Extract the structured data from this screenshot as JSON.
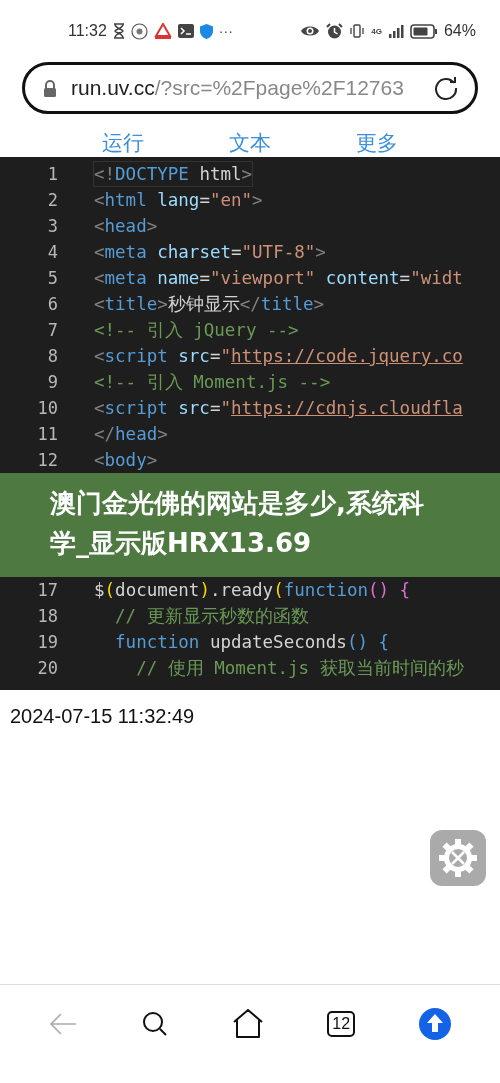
{
  "status_bar": {
    "time": "11:32",
    "more": "···",
    "network": "4G",
    "battery": "64%"
  },
  "address_bar": {
    "host": "run.uv.cc",
    "path": "/?src=%2Fpage%2F12763"
  },
  "toolbar": [
    {
      "label": "运行"
    },
    {
      "label": "文本"
    },
    {
      "label": "更多"
    }
  ],
  "editor": {
    "lines_top": [
      {
        "number": "1",
        "current": true,
        "tokens": [
          {
            "kind": "p",
            "t": "<!"
          },
          {
            "kind": "tag",
            "t": "DOCTYPE"
          },
          {
            "kind": "txt",
            "t": " html"
          },
          {
            "kind": "p",
            "t": ">"
          }
        ]
      },
      {
        "number": "2",
        "current": false,
        "tokens": [
          {
            "kind": "p",
            "t": "<"
          },
          {
            "kind": "tag",
            "t": "html"
          },
          {
            "kind": "attr",
            "t": " lang"
          },
          {
            "kind": "txt",
            "t": "="
          },
          {
            "kind": "str",
            "t": "\"en\""
          },
          {
            "kind": "p",
            "t": ">"
          }
        ]
      },
      {
        "number": "3",
        "current": false,
        "tokens": [
          {
            "kind": "p",
            "t": "<"
          },
          {
            "kind": "tag",
            "t": "head"
          },
          {
            "kind": "p",
            "t": ">"
          }
        ]
      },
      {
        "number": "4",
        "current": false,
        "tokens": [
          {
            "kind": "p",
            "t": "<"
          },
          {
            "kind": "tag",
            "t": "meta"
          },
          {
            "kind": "attr",
            "t": " charset"
          },
          {
            "kind": "txt",
            "t": "="
          },
          {
            "kind": "str",
            "t": "\"UTF-8\""
          },
          {
            "kind": "p",
            "t": ">"
          }
        ]
      },
      {
        "number": "5",
        "current": false,
        "tokens": [
          {
            "kind": "p",
            "t": "<"
          },
          {
            "kind": "tag",
            "t": "meta"
          },
          {
            "kind": "attr",
            "t": " name"
          },
          {
            "kind": "txt",
            "t": "="
          },
          {
            "kind": "str",
            "t": "\"viewport\""
          },
          {
            "kind": "attr",
            "t": " content"
          },
          {
            "kind": "txt",
            "t": "="
          },
          {
            "kind": "str",
            "t": "\"widt"
          }
        ]
      },
      {
        "number": "6",
        "current": false,
        "tokens": [
          {
            "kind": "p",
            "t": "<"
          },
          {
            "kind": "tag",
            "t": "title"
          },
          {
            "kind": "p",
            "t": ">"
          },
          {
            "kind": "txt",
            "t": "秒钟显示"
          },
          {
            "kind": "p",
            "t": "</"
          },
          {
            "kind": "tag",
            "t": "title"
          },
          {
            "kind": "p",
            "t": ">"
          }
        ]
      },
      {
        "number": "7",
        "current": false,
        "tokens": [
          {
            "kind": "com",
            "t": "<!-- 引入 jQuery -->"
          }
        ]
      },
      {
        "number": "8",
        "current": false,
        "tokens": [
          {
            "kind": "p",
            "t": "<"
          },
          {
            "kind": "tag",
            "t": "script"
          },
          {
            "kind": "attr",
            "t": " src"
          },
          {
            "kind": "txt",
            "t": "="
          },
          {
            "kind": "str",
            "t": "\""
          },
          {
            "kind": "link",
            "t": "https://code.jquery.co"
          }
        ]
      },
      {
        "number": "9",
        "current": false,
        "tokens": [
          {
            "kind": "com",
            "t": "<!-- 引入 Moment.js -->"
          }
        ]
      },
      {
        "number": "10",
        "current": false,
        "tokens": [
          {
            "kind": "p",
            "t": "<"
          },
          {
            "kind": "tag",
            "t": "script"
          },
          {
            "kind": "attr",
            "t": " src"
          },
          {
            "kind": "txt",
            "t": "="
          },
          {
            "kind": "str",
            "t": "\""
          },
          {
            "kind": "link",
            "t": "https://cdnjs.cloudfla"
          }
        ]
      },
      {
        "number": "11",
        "current": false,
        "tokens": [
          {
            "kind": "p",
            "t": "</"
          },
          {
            "kind": "tag",
            "t": "head"
          },
          {
            "kind": "p",
            "t": ">"
          }
        ]
      },
      {
        "number": "12",
        "current": false,
        "tokens": [
          {
            "kind": "p",
            "t": "<"
          },
          {
            "kind": "tag",
            "t": "body"
          },
          {
            "kind": "p",
            "t": ">"
          }
        ]
      }
    ],
    "lines_bottom": [
      {
        "number": "17",
        "current": false,
        "tokens": [
          {
            "kind": "txt",
            "t": "$"
          },
          {
            "kind": "paren",
            "t": "("
          },
          {
            "kind": "txt",
            "t": "document"
          },
          {
            "kind": "paren",
            "t": ")"
          },
          {
            "kind": "txt",
            "t": ".ready"
          },
          {
            "kind": "paren",
            "t": "("
          },
          {
            "kind": "kw",
            "t": "function"
          },
          {
            "kind": "brace",
            "t": "() {"
          }
        ]
      },
      {
        "number": "18",
        "current": false,
        "tokens": [
          {
            "kind": "com",
            "t": "  // 更新显示秒数的函数"
          }
        ]
      },
      {
        "number": "19",
        "current": false,
        "tokens": [
          {
            "kind": "kw",
            "t": "  function"
          },
          {
            "kind": "txt",
            "t": " updateSeconds"
          },
          {
            "kind": "kw",
            "t": "() {"
          }
        ]
      },
      {
        "number": "20",
        "current": false,
        "tokens": [
          {
            "kind": "com",
            "t": "    // 使用 Moment.js 获取当前时间的秒"
          }
        ]
      }
    ]
  },
  "banner": {
    "title": "澳门金光佛的网站是多少,系统科学_显示版HRX13.69"
  },
  "output": {
    "text": "2024-07-15 11:32:49"
  },
  "bottom_nav": [
    {
      "kind": "back",
      "disabled": true
    },
    {
      "kind": "search",
      "disabled": false
    },
    {
      "kind": "home",
      "disabled": false
    },
    {
      "kind": "tabs",
      "count": "12",
      "disabled": false
    },
    {
      "kind": "upload",
      "disabled": false
    }
  ]
}
